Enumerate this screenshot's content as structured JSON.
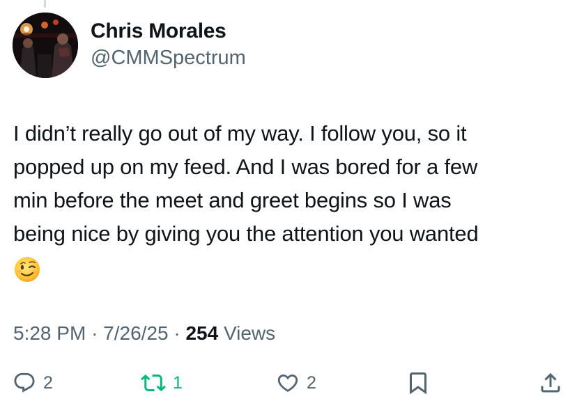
{
  "author": {
    "display_name": "Chris Morales",
    "handle": "@CMMSpectrum",
    "avatar_icon": "concert-photo-avatar"
  },
  "tweet": {
    "text_lines": [
      "I didn’t really go out of my way. I follow you, so it",
      "popped up on my feed. And I was bored  for a few",
      "min before the meet and greet begins so I was",
      "being nice by giving you the attention you wanted"
    ],
    "emoji": "winking-face-emoji"
  },
  "meta": {
    "time": "5:28 PM",
    "separator": "·",
    "date": "7/26/25",
    "views_count": "254",
    "views_label": "Views"
  },
  "actions": {
    "reply_count": "2",
    "retweet_count": "1",
    "like_count": "2",
    "icons": [
      "reply-icon",
      "retweet-icon",
      "like-icon",
      "bookmark-icon",
      "share-icon"
    ]
  },
  "colors": {
    "text_primary": "#0f1419",
    "text_secondary": "#536471",
    "retweet_active": "#00ba7c",
    "background": "#ffffff"
  }
}
